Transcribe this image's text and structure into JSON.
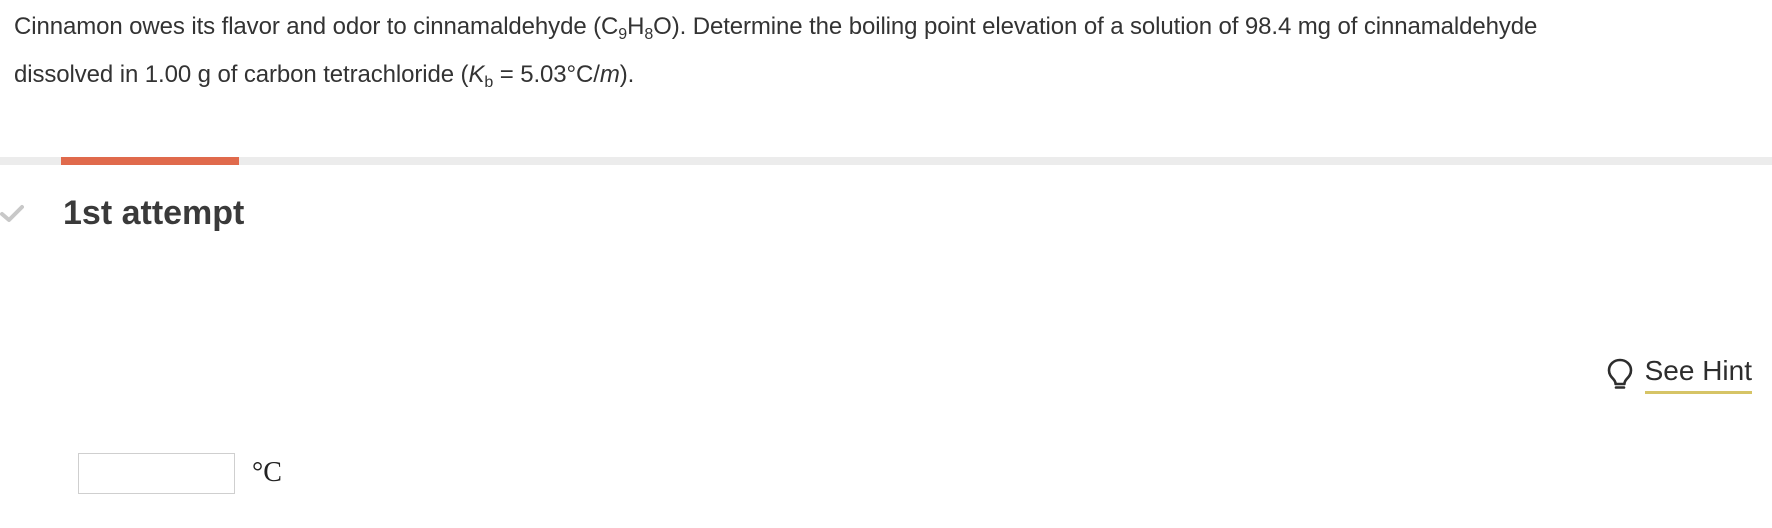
{
  "question": {
    "line1_prefix": "Cinnamon owes its flavor and odor to cinnamaldehyde (C",
    "sub_c": "9",
    "h": "H",
    "sub_h": "8",
    "line1_suffix": "O). Determine the boiling point elevation of a solution of 98.4 mg of cinnamaldehyde",
    "line2_prefix": "dissolved in 1.00 g of carbon tetrachloride (",
    "kb_symbol": "K",
    "kb_sub": "b",
    "kb_value": " = 5.03°C/",
    "molal_symbol": "m",
    "line2_suffix": ")."
  },
  "attempt": {
    "title": "1st attempt",
    "progress_fraction": 0.104
  },
  "hint": {
    "label": "See Hint",
    "icon": "lightbulb-icon"
  },
  "answer": {
    "value": "",
    "placeholder": "",
    "unit": "°C"
  },
  "colors": {
    "progress_fill": "#e06a4c",
    "progress_track": "#ececec",
    "hint_underline": "#d6c466",
    "check": "#c8c8c8"
  }
}
